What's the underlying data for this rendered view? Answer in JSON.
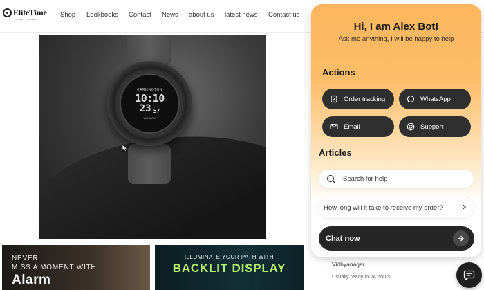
{
  "header": {
    "logo_text": "EliteTime",
    "logo_subtext": "LUXURY WATCHES",
    "nav": [
      {
        "label": "Shop"
      },
      {
        "label": "Lookbooks"
      },
      {
        "label": "Contact"
      },
      {
        "label": "News"
      },
      {
        "label": "about us"
      },
      {
        "label": "latest news"
      },
      {
        "label": "Contact us"
      }
    ]
  },
  "product": {
    "watch_brand": "CARLINGTON",
    "display_time": "10:10",
    "display_seconds": "23",
    "display_small": "57",
    "water_resist": "WR 5ATM"
  },
  "banners": {
    "alarm": {
      "line1": "NEVER",
      "line2": "MISS A MOMENT WITH",
      "line3": "Alarm"
    },
    "backlit": {
      "line1": "ILLUMINATE YOUR PATH WITH",
      "line2": "BACKLIT DISPLAY"
    }
  },
  "store": {
    "location": "Vidhyanagar",
    "availability": "Usually ready in 24 hours"
  },
  "widget": {
    "title": "Hi, I am Alex Bot!",
    "subtitle": "Ask me anything, I will be happy to help",
    "actions_heading": "Actions",
    "actions": [
      {
        "label": "Order tracking",
        "icon": "order-tracking-icon"
      },
      {
        "label": "WhatsApp",
        "icon": "whatsapp-icon"
      },
      {
        "label": "Email",
        "icon": "email-icon"
      },
      {
        "label": "Support",
        "icon": "support-icon"
      }
    ],
    "articles_heading": "Articles",
    "search_placeholder": "Search for help",
    "articles": [
      {
        "label": "How long will it take to receive my order?"
      }
    ],
    "chat_now_label": "Chat now"
  },
  "colors": {
    "widget_gradient_top": "#fdb65d",
    "widget_button_dark": "#2f2f2f",
    "backlit_accent": "#b6f26a"
  }
}
